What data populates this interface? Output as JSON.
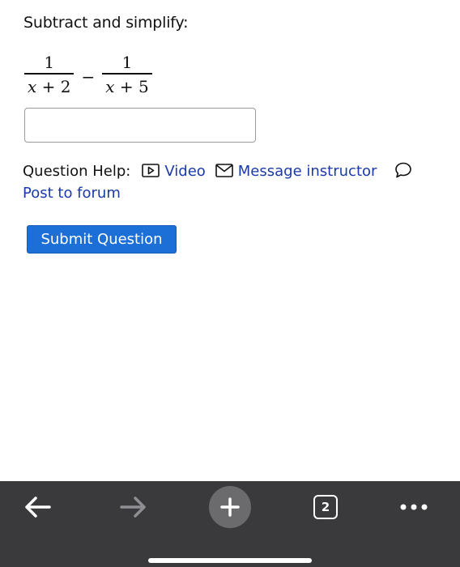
{
  "question": {
    "prompt": "Subtract and simplify:",
    "expression": {
      "left": {
        "numerator": "1",
        "den_var": "x",
        "den_rest": " + 2"
      },
      "operator": "−",
      "right": {
        "numerator": "1",
        "den_var": "x",
        "den_rest": " + 5"
      }
    },
    "answer_value": ""
  },
  "help": {
    "label": "Question Help:",
    "video_label": "Video",
    "message_label": "Message instructor",
    "forum_label": "Post to forum"
  },
  "submit_label": "Submit Question",
  "toolbar": {
    "tab_count": "2",
    "icons": [
      "back-arrow-icon",
      "forward-arrow-icon",
      "plus-icon",
      "tabs-icon",
      "more-icon"
    ]
  },
  "colors": {
    "link": "#1a3aa8",
    "submit_bg": "#1b6fd6",
    "toolbar_bg": "#3a3a3c"
  }
}
